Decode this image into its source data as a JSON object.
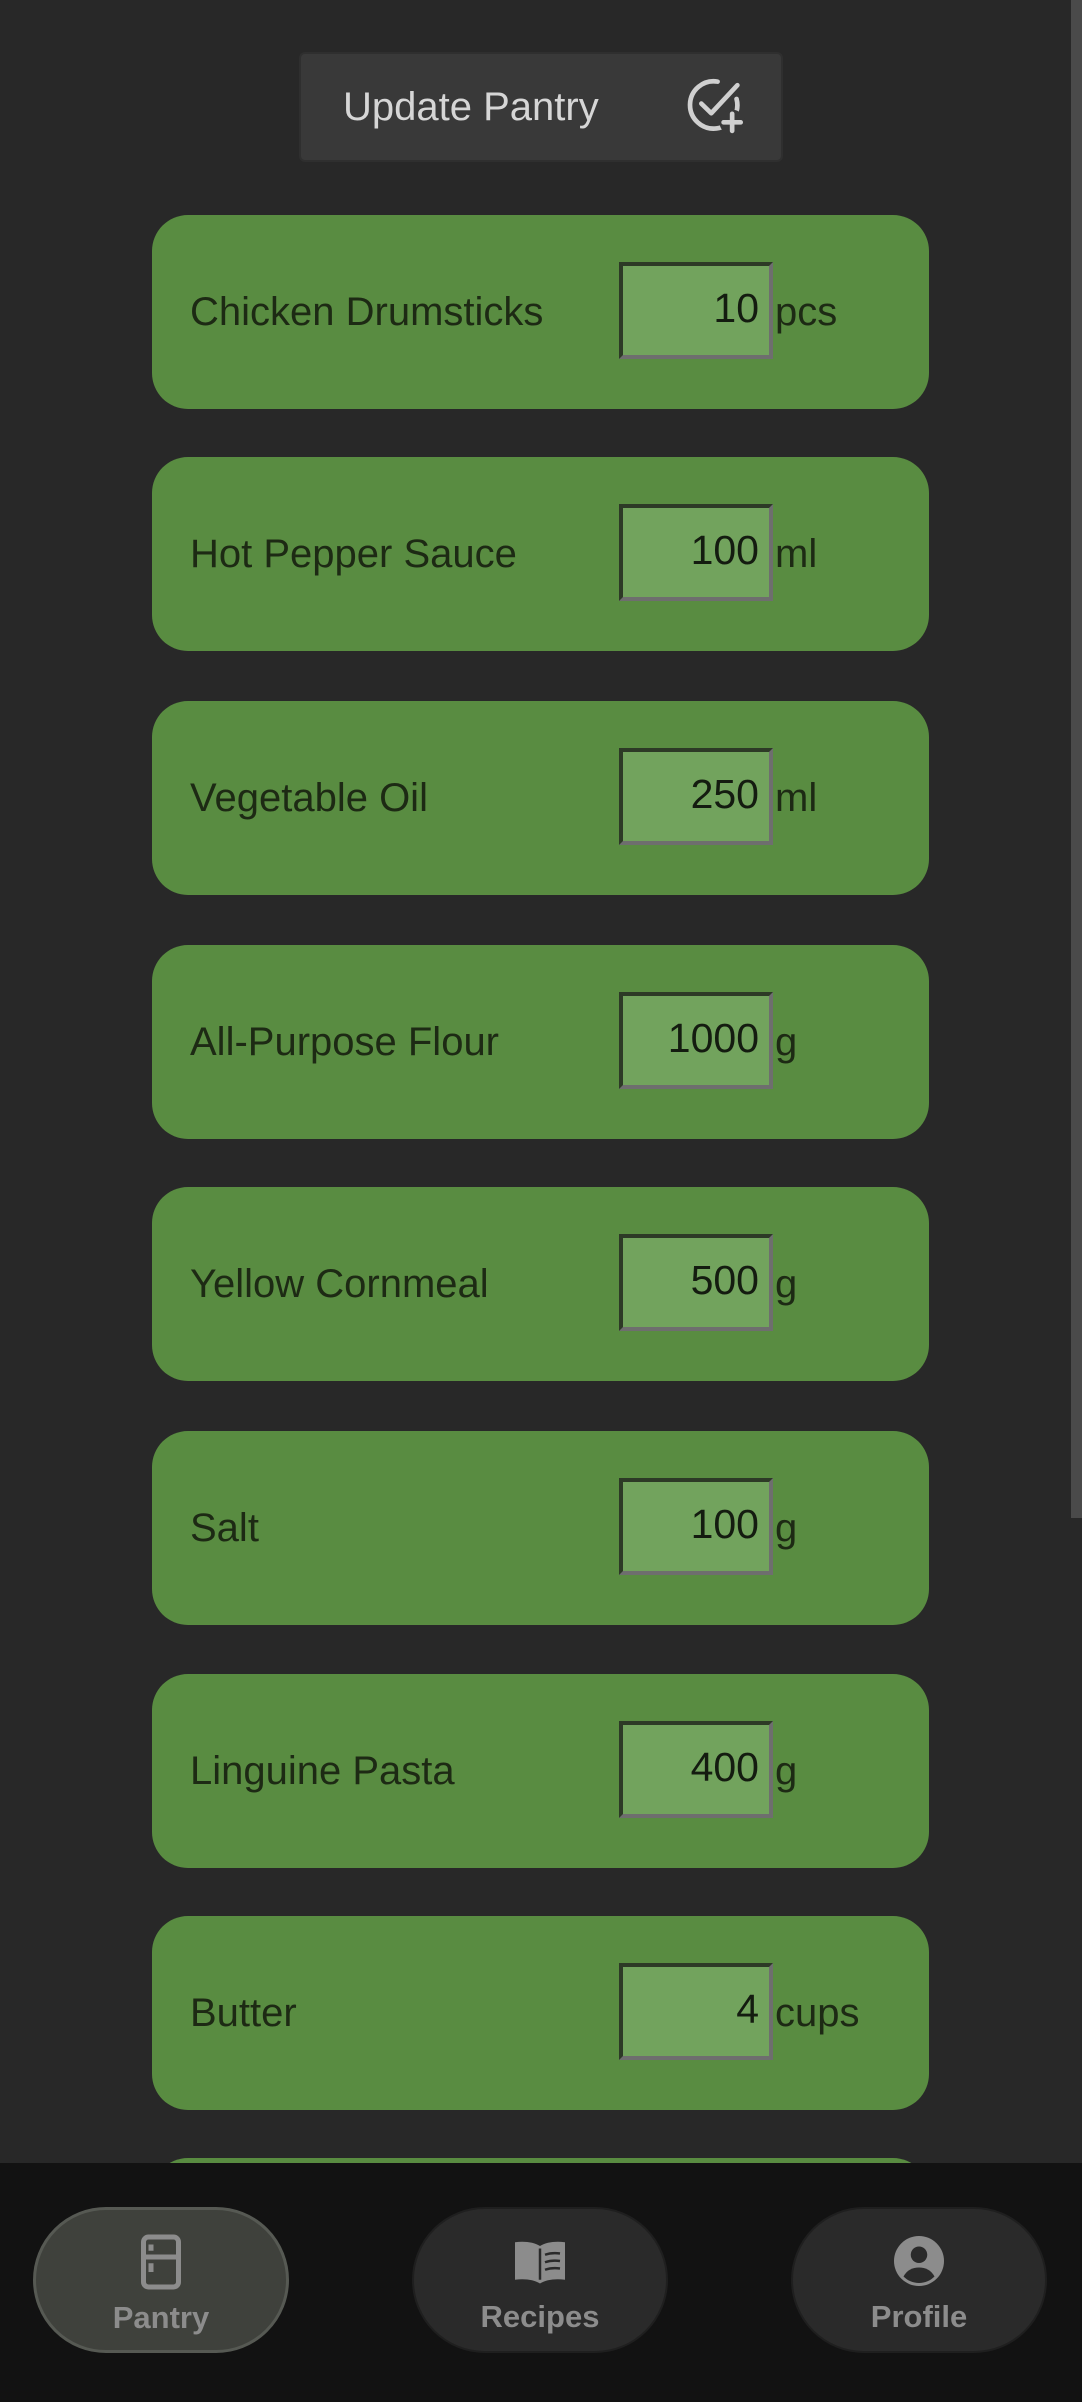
{
  "header": {
    "update_button_label": "Update Pantry",
    "update_button_icon": "check-circle-plus-icon"
  },
  "pantry": {
    "items": [
      {
        "name": "Chicken Drumsticks",
        "quantity": "10",
        "unit": "pcs"
      },
      {
        "name": "Hot Pepper Sauce",
        "quantity": "100",
        "unit": "ml"
      },
      {
        "name": "Vegetable Oil",
        "quantity": "250",
        "unit": "ml"
      },
      {
        "name": "All-Purpose Flour",
        "quantity": "1000",
        "unit": "g"
      },
      {
        "name": "Yellow Cornmeal",
        "quantity": "500",
        "unit": "g"
      },
      {
        "name": "Salt",
        "quantity": "100",
        "unit": "g"
      },
      {
        "name": "Linguine Pasta",
        "quantity": "400",
        "unit": "g"
      },
      {
        "name": "Butter",
        "quantity": "4",
        "unit": "cups"
      }
    ]
  },
  "nav": {
    "items": [
      {
        "label": "Pantry",
        "icon": "fridge-icon",
        "active": true
      },
      {
        "label": "Recipes",
        "icon": "book-icon",
        "active": false
      },
      {
        "label": "Profile",
        "icon": "account-circle-icon",
        "active": false
      }
    ]
  },
  "colors": {
    "background": "#282828",
    "item_card": "#598c41",
    "input_fill": "#72a35d",
    "nav_background": "#121212"
  }
}
